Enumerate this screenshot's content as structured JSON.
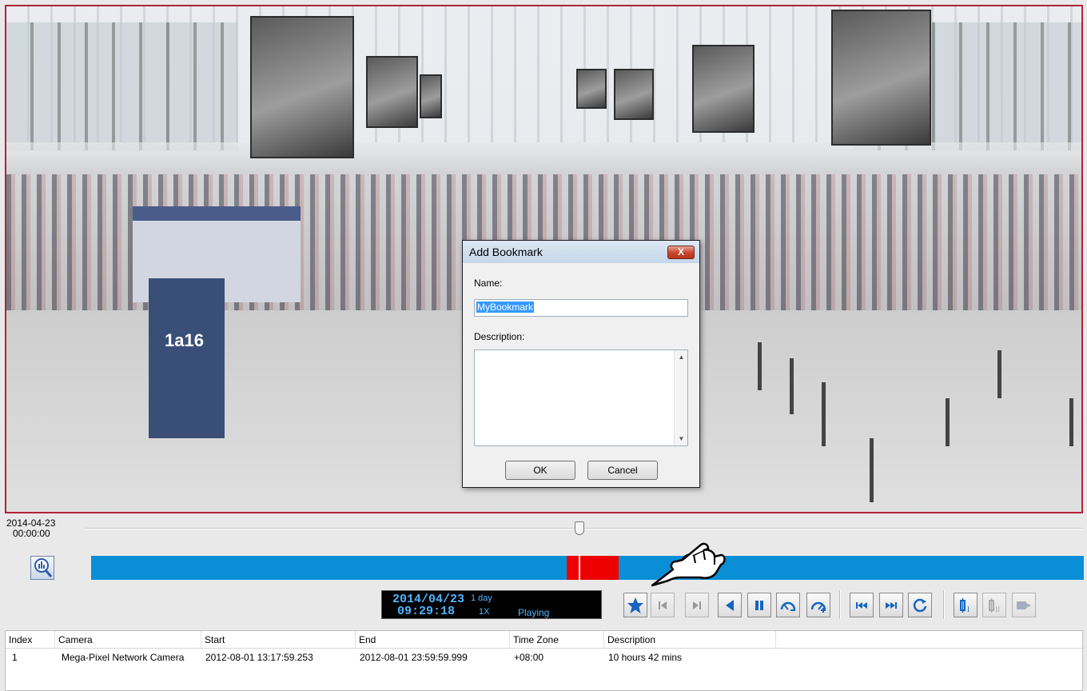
{
  "dialog": {
    "title": "Add Bookmark",
    "close_label": "X",
    "name_label": "Name:",
    "name_value": "MyBookmark",
    "description_label": "Description:",
    "ok_label": "OK",
    "cancel_label": "Cancel"
  },
  "timeline": {
    "start_date": "2014-04-23",
    "start_time": "00:00:00",
    "slider_position": 0.5
  },
  "status": {
    "date": "2014/04/23",
    "time": "09:29:18",
    "range": "1 day",
    "speed": "1X",
    "state": "Playing"
  },
  "controls": [
    {
      "name": "bookmark-button",
      "icon": "star-icon",
      "enabled": true
    },
    {
      "name": "previous-frame-button",
      "icon": "prev-frame-icon",
      "enabled": false
    },
    {
      "name": "next-frame-button",
      "icon": "next-frame-icon",
      "enabled": false
    },
    {
      "name": "play-backward-button",
      "icon": "play-backward-icon",
      "enabled": true
    },
    {
      "name": "pause-button",
      "icon": "pause-icon",
      "enabled": true
    },
    {
      "name": "slow-down-button",
      "icon": "speed-down-icon",
      "enabled": true
    },
    {
      "name": "speed-up-button",
      "icon": "speed-up-icon",
      "enabled": true
    },
    {
      "name": "previous-segment-button",
      "icon": "skip-back-icon",
      "enabled": true
    },
    {
      "name": "next-segment-button",
      "icon": "skip-forward-icon",
      "enabled": true
    },
    {
      "name": "repeat-button",
      "icon": "repeat-icon",
      "enabled": true
    },
    {
      "name": "mark-in-button",
      "icon": "mark-in-icon",
      "enabled": true
    },
    {
      "name": "mark-out-button",
      "icon": "mark-out-icon",
      "enabled": false
    },
    {
      "name": "export-button",
      "icon": "export-video-icon",
      "enabled": false
    }
  ],
  "table": {
    "columns": [
      "Index",
      "Camera",
      "Start",
      "End",
      "Time Zone",
      "Description"
    ],
    "rows": [
      [
        "1",
        "Mega-Pixel Network Camera",
        "2012-08-01 13:17:59.253",
        "2012-08-01 23:59:59.999",
        "+08:00",
        "10 hours 42 mins"
      ]
    ]
  },
  "colors": {
    "timeline_bar": "#0a8fd6",
    "recorded_segment": "#ee0000",
    "video_border": "#b0223d",
    "status_text": "#4fb6ff"
  },
  "video": {
    "sign_text": "1a16"
  }
}
